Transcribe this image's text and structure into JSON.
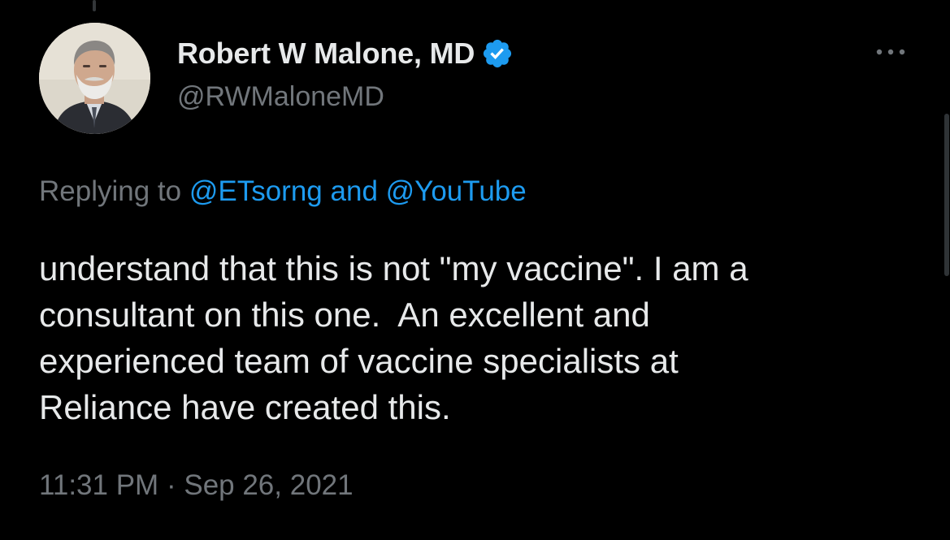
{
  "tweet": {
    "author": {
      "display_name": "Robert W Malone, MD",
      "handle": "@RWMaloneMD",
      "verified": true,
      "avatar_icon": "profile-photo"
    },
    "more_icon": "more-horizontal-icon",
    "reply_context": {
      "prefix": "Replying to",
      "mention_1": "@ETsorng",
      "conjunction": "and",
      "mention_2": "@YouTube"
    },
    "text": "understand that this is not \"my vaccine\". I am a\nconsultant on this one.  An excellent and\nexperienced team of vaccine specialists at\nReliance have created this.",
    "timestamp": {
      "time": "11:31 PM",
      "separator": "·",
      "date": "Sep 26, 2021"
    }
  },
  "colors": {
    "background": "#000000",
    "primary_text": "#e7e9ea",
    "secondary_text": "#71767b",
    "accent_blue": "#1d9bf0"
  }
}
